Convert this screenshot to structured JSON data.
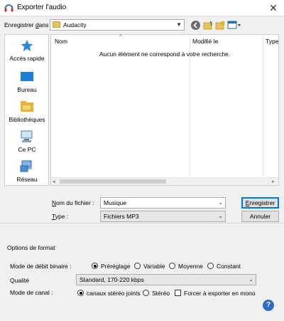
{
  "window": {
    "title": "Exporter l'audio",
    "close_glyph": "✕"
  },
  "location": {
    "label_prefix": "Enregistrer ",
    "label_accel": "d",
    "label_suffix": "ans :",
    "folder": "Audacity"
  },
  "places": [
    {
      "label": "Accès rapide",
      "icon": "star-icon"
    },
    {
      "label": "Bureau",
      "icon": "desktop-icon"
    },
    {
      "label": "Bibliothèques",
      "icon": "libraries-icon"
    },
    {
      "label": "Ce PC",
      "icon": "computer-icon"
    },
    {
      "label": "Réseau",
      "icon": "network-icon"
    }
  ],
  "filelist": {
    "columns": [
      "Nom",
      "Modifié le",
      "Type"
    ],
    "sort_glyph": "^",
    "empty_message": "Aucun élément ne correspond à votre recherche."
  },
  "filename": {
    "label_accel": "N",
    "label_rest": "om du fichier :",
    "value": "Musique"
  },
  "filetype": {
    "label_accel": "T",
    "label_rest": "ype :",
    "value": "Fichiers MP3"
  },
  "buttons": {
    "save_accel": "E",
    "save_rest": "nregistrer",
    "cancel": "Annuler",
    "help": "?"
  },
  "options": {
    "group_title": "Options de format",
    "bitrate_mode_label": "Mode de débit binaire :",
    "bitrate_modes": [
      "Préréglage",
      "Variable",
      "Moyenne",
      "Constant"
    ],
    "bitrate_selected": "Préréglage",
    "quality_label": "Qualité",
    "quality_value": "Standard, 170-220 kbps",
    "channel_mode_label": "Mode de canal :",
    "channel_modes": [
      "canaux stéréo joints",
      "Stéréo"
    ],
    "channel_selected": "canaux stéréo joints",
    "force_mono_label": "Forcer à exporter en mono",
    "force_mono_checked": false
  },
  "colors": {
    "accent": "#0078d7",
    "dialog_bg": "#f0f0f0",
    "help_blue": "#2b6cc4"
  }
}
